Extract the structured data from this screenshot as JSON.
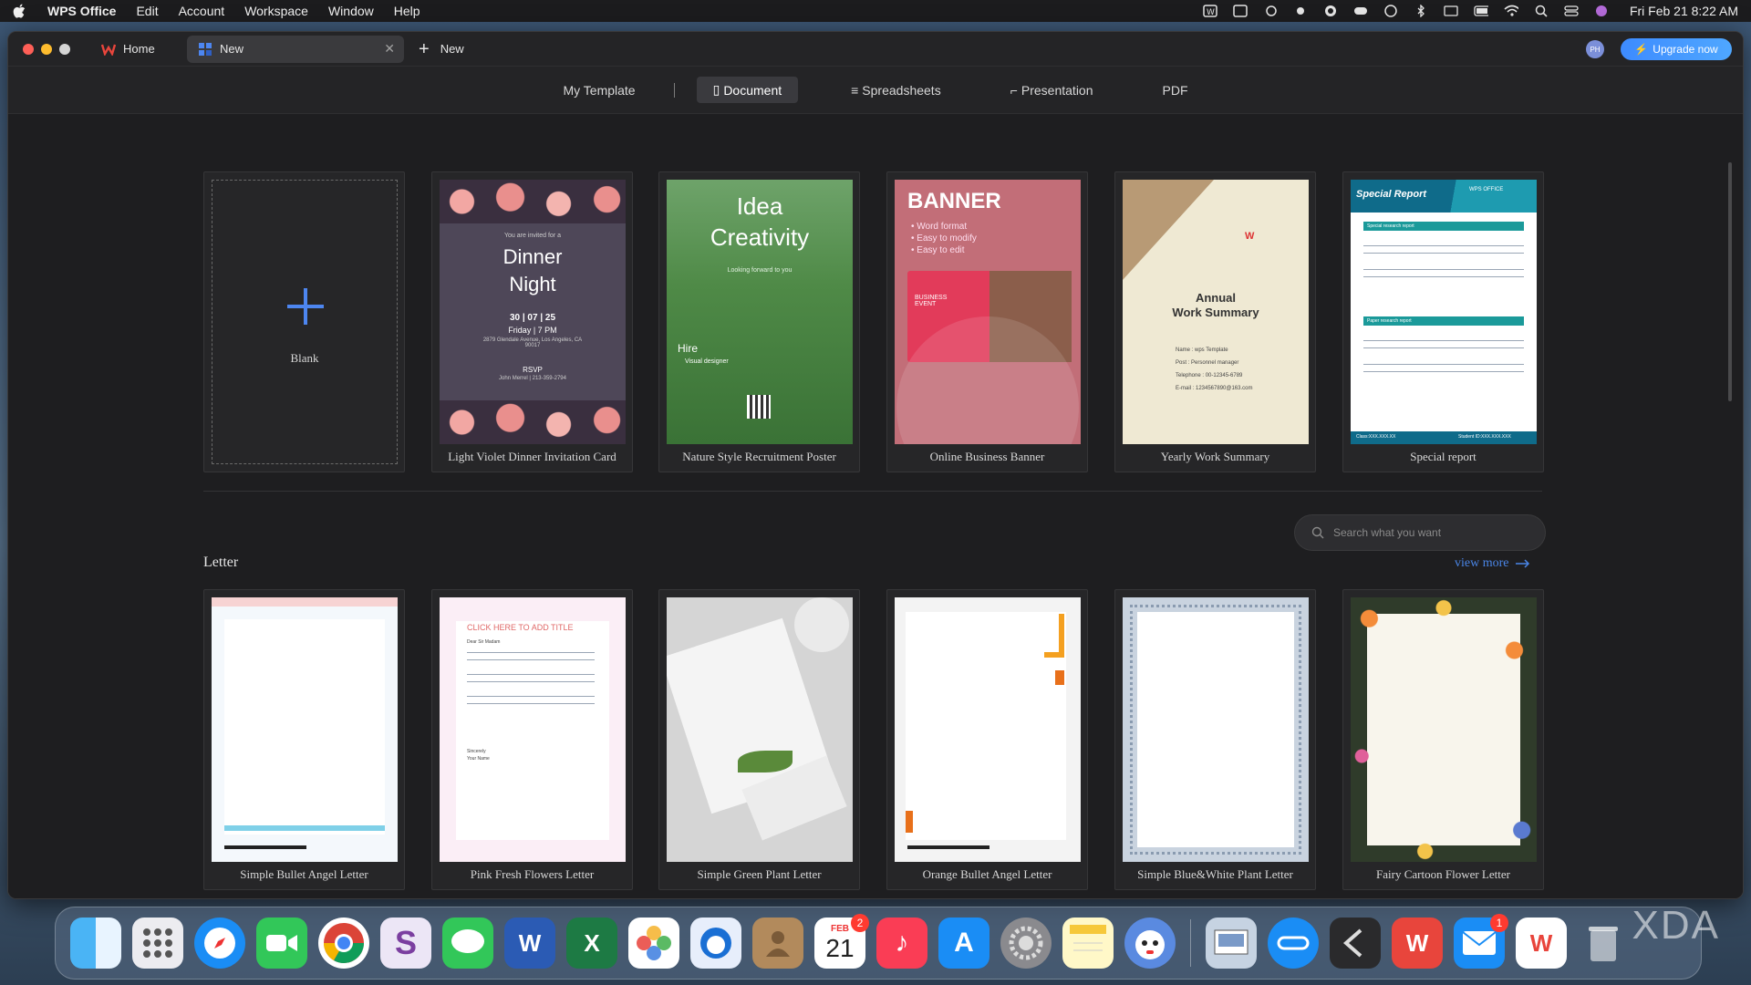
{
  "menubar": {
    "app_name": "WPS Office",
    "items": [
      "Edit",
      "Account",
      "Workspace",
      "Window",
      "Help"
    ],
    "clock": "Fri Feb 21  8:22 AM"
  },
  "window": {
    "tabs": [
      {
        "label": "Home"
      },
      {
        "label": "New"
      }
    ],
    "new_tab_label": "New",
    "avatar_initials": "PH",
    "upgrade_label": "Upgrade now"
  },
  "categories": {
    "my_template": "My Template",
    "document": "Document",
    "spreadsheets": "Spreadsheets",
    "presentation": "Presentation",
    "pdf": "PDF"
  },
  "featured": {
    "blank_label": "Blank",
    "cards": [
      {
        "label": "Light Violet Dinner Invitation Card"
      },
      {
        "label": "Nature Style Recruitment Poster"
      },
      {
        "label": "Online Business Banner"
      },
      {
        "label": "Yearly Work Summary"
      },
      {
        "label": "Special report"
      }
    ]
  },
  "thumbs": {
    "dinner": {
      "invite": "You are invited for a",
      "title1": "Dinner",
      "title2": "Night",
      "date": "30 | 07 | 25",
      "time": "Friday | 7 PM",
      "addr": "2879 Glendale Avenue, Los Angeles, CA 90017",
      "rsvp": "RSVP",
      "contact": "John Merrel | 213-359-2794"
    },
    "nature": {
      "title1": "Idea",
      "title2": "Creativity",
      "sub": "Looking forward to you",
      "hire": "Hire",
      "role": "Visual designer"
    },
    "banner": {
      "title": "BANNER",
      "b1": "• Word format",
      "b2": "• Easy to modify",
      "b3": "• Easy to edit",
      "event": "BUSINESS EVENT"
    },
    "annual": {
      "title1": "Annual",
      "title2": "Work Summary",
      "name": "Name : wps Template",
      "post": "Post : Personnel manager",
      "tel": "Telephone : 00-12345-6789",
      "email": "E-mail : 1234567890@163.com"
    },
    "special": {
      "title": "Special Report",
      "brand": "WPS OFFICE",
      "sec1": "Special research report",
      "sec2": "Paper research report",
      "foot1": "Class:XXX.XXX.XX",
      "foot2": "Student ID:XXX.XXX.XXX"
    },
    "pink": {
      "title": "CLICK HERE TO ADD TITLE",
      "greeting": "Dear Sir Madam",
      "sign": "Sincerely",
      "name": "Your Name"
    }
  },
  "search": {
    "placeholder": "Search what you want"
  },
  "letter_section": {
    "title": "Letter",
    "view_more": "view more",
    "cards": [
      {
        "label": "Simple Bullet Angel Letter"
      },
      {
        "label": "Pink Fresh Flowers Letter"
      },
      {
        "label": "Simple Green Plant Letter"
      },
      {
        "label": "Orange Bullet Angel Letter"
      },
      {
        "label": "Simple Blue&White Plant Letter"
      },
      {
        "label": "Fairy Cartoon Flower Letter"
      }
    ]
  },
  "dock": {
    "calendar_month": "FEB",
    "calendar_day": "21",
    "calendar_badge": "2",
    "mail_badge": "1"
  },
  "watermark": "XDA",
  "colors": {
    "accent": "#4d86f0",
    "upgrade": "#3d8bff",
    "link": "#4a86e8"
  }
}
